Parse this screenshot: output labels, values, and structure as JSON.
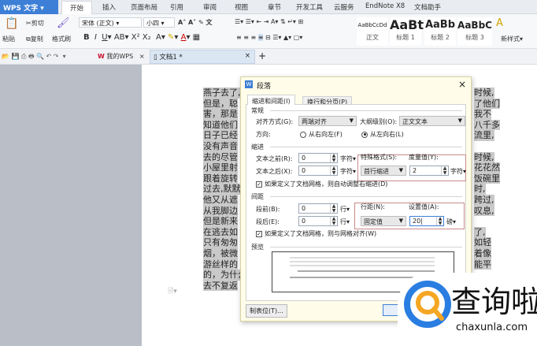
{
  "app": {
    "name": "WPS 文字"
  },
  "tabs": [
    "开始",
    "插入",
    "页面布局",
    "引用",
    "审阅",
    "视图",
    "章节",
    "开发工具",
    "云服务",
    "EndNote X8",
    "文档助手"
  ],
  "ribbon": {
    "paste": "粘贴",
    "cut": "剪切",
    "copy": "复制",
    "format_painter": "格式刷",
    "font": "宋体 (正文)",
    "size": "小四",
    "styles": [
      {
        "sample": "AaBbCcDd",
        "name": "正文"
      },
      {
        "sample": "AaBt",
        "name": "标题 1"
      },
      {
        "sample": "AaBb",
        "name": "标题 2"
      },
      {
        "sample": "AaBbC",
        "name": "标题 3"
      }
    ],
    "new_style": "新样式"
  },
  "doc_tabs": {
    "my_wps": "我的WPS",
    "doc": "文档1 *"
  },
  "document": {
    "left_lines": [
      "燕子去了,",
      "但是，聪",
      "害，那是",
      "知道他们",
      "日子已经",
      "没有声音",
      "去的尽管",
      "小屋里射",
      "跟着旋转",
      "过去,默默",
      "他又从遮",
      "从我脚边",
      "但是新来",
      "在逃去如",
      "只有匆匆",
      "烟，被微",
      "游丝样的",
      "的，为什么",
      "去不复返"
    ],
    "right_lines": [
      "时候,",
      "了他们",
      "我不",
      "八千多",
      "流里,",
      "",
      "时候,",
      "花花然",
      "饭碗里",
      "时,",
      "跨过,",
      "叹息,",
      "",
      "了,",
      "如轻",
      "着像",
      "能平"
    ]
  },
  "dialog": {
    "title": "段落",
    "tabs": [
      "缩进和间距(I)",
      "换行和分页(P)"
    ],
    "general": "常规",
    "alignment_label": "对齐方式(G):",
    "alignment": "两端对齐",
    "outline_label": "大纲级别(O):",
    "outline": "正文文本",
    "direction_label": "方向:",
    "rtl": "从右向左(F)",
    "ltr": "从左向右(L)",
    "indent": "缩进",
    "before_text_label": "文本之前(R):",
    "before_text": "0",
    "after_text_label": "文本之后(X):",
    "after_text": "0",
    "unit_char": "字符▾",
    "special_label": "特殊格式(S):",
    "special": "首行缩进",
    "measure_label": "度量值(Y):",
    "measure": "2",
    "auto_indent": "如果定义了文档网格，则自动调整右缩进(D)",
    "spacing": "间距",
    "before_label": "段前(B):",
    "before": "0",
    "after_label": "段后(E):",
    "after": "0",
    "unit_line": "行▾",
    "line_spacing_label": "行距(N):",
    "line_spacing": "固定值",
    "set_value_label": "设置值(A):",
    "set_value": "20",
    "unit_pt": "磅▾",
    "snap_grid": "如果定义了文档网格，则与网格对齐(W)",
    "preview": "预览",
    "tabs_button": "制表位(T)..."
  },
  "watermark": {
    "brand": "查询啦",
    "url": "chaxunla.com"
  },
  "colors": {
    "accent": "#3d7fd6",
    "selection": "#c9c9c9"
  }
}
